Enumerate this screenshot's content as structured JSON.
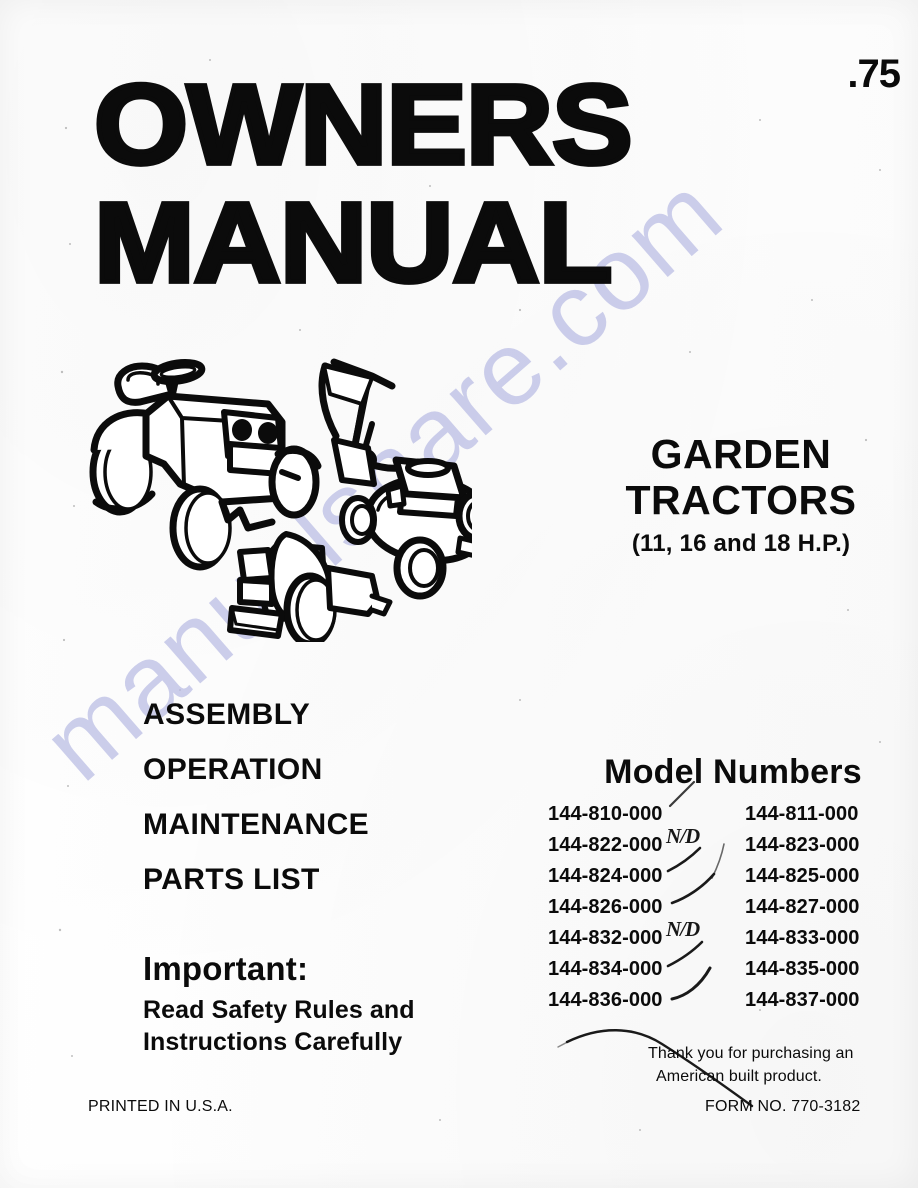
{
  "document": {
    "kind": "owners-manual-cover",
    "price": ".75"
  },
  "masthead": {
    "line1": "OWNERS",
    "line2": "MANUAL"
  },
  "product": {
    "line1": "GARDEN",
    "line2": "TRACTORS",
    "horsepower": "(11, 16 and 18 H.P.)"
  },
  "sections": {
    "items": [
      {
        "label": "ASSEMBLY"
      },
      {
        "label": "OPERATION"
      },
      {
        "label": "MAINTENANCE"
      },
      {
        "label": "PARTS LIST"
      }
    ]
  },
  "important": {
    "heading": "Important:",
    "line1": "Read Safety Rules and",
    "line2": "Instructions Carefully"
  },
  "models": {
    "title": "Model Numbers",
    "rows": [
      {
        "left": "144-810-000",
        "right": "144-811-000",
        "annotation": ""
      },
      {
        "left": "144-822-000",
        "right": "144-823-000",
        "annotation": "N/D"
      },
      {
        "left": "144-824-000",
        "right": "144-825-000",
        "annotation": ""
      },
      {
        "left": "144-826-000",
        "right": "144-827-000",
        "annotation": ""
      },
      {
        "left": "144-832-000",
        "right": "144-833-000",
        "annotation": "N/D"
      },
      {
        "left": "144-834-000",
        "right": "144-835-000",
        "annotation": ""
      },
      {
        "left": "144-836-000",
        "right": "144-837-000",
        "annotation": ""
      }
    ]
  },
  "footer": {
    "printed_in": "PRINTED IN U.S.A.",
    "thanks_line1": "Thank you for purchasing an",
    "thanks_line2": "American built product.",
    "form_no": "FORM NO. 770-3182"
  },
  "watermark": {
    "text": "manualshare.com",
    "color": "#b9bce4"
  },
  "illustration": {
    "caption": "line-art of a garden tractor, a tiller attachment and a walk-behind lawn mower"
  }
}
